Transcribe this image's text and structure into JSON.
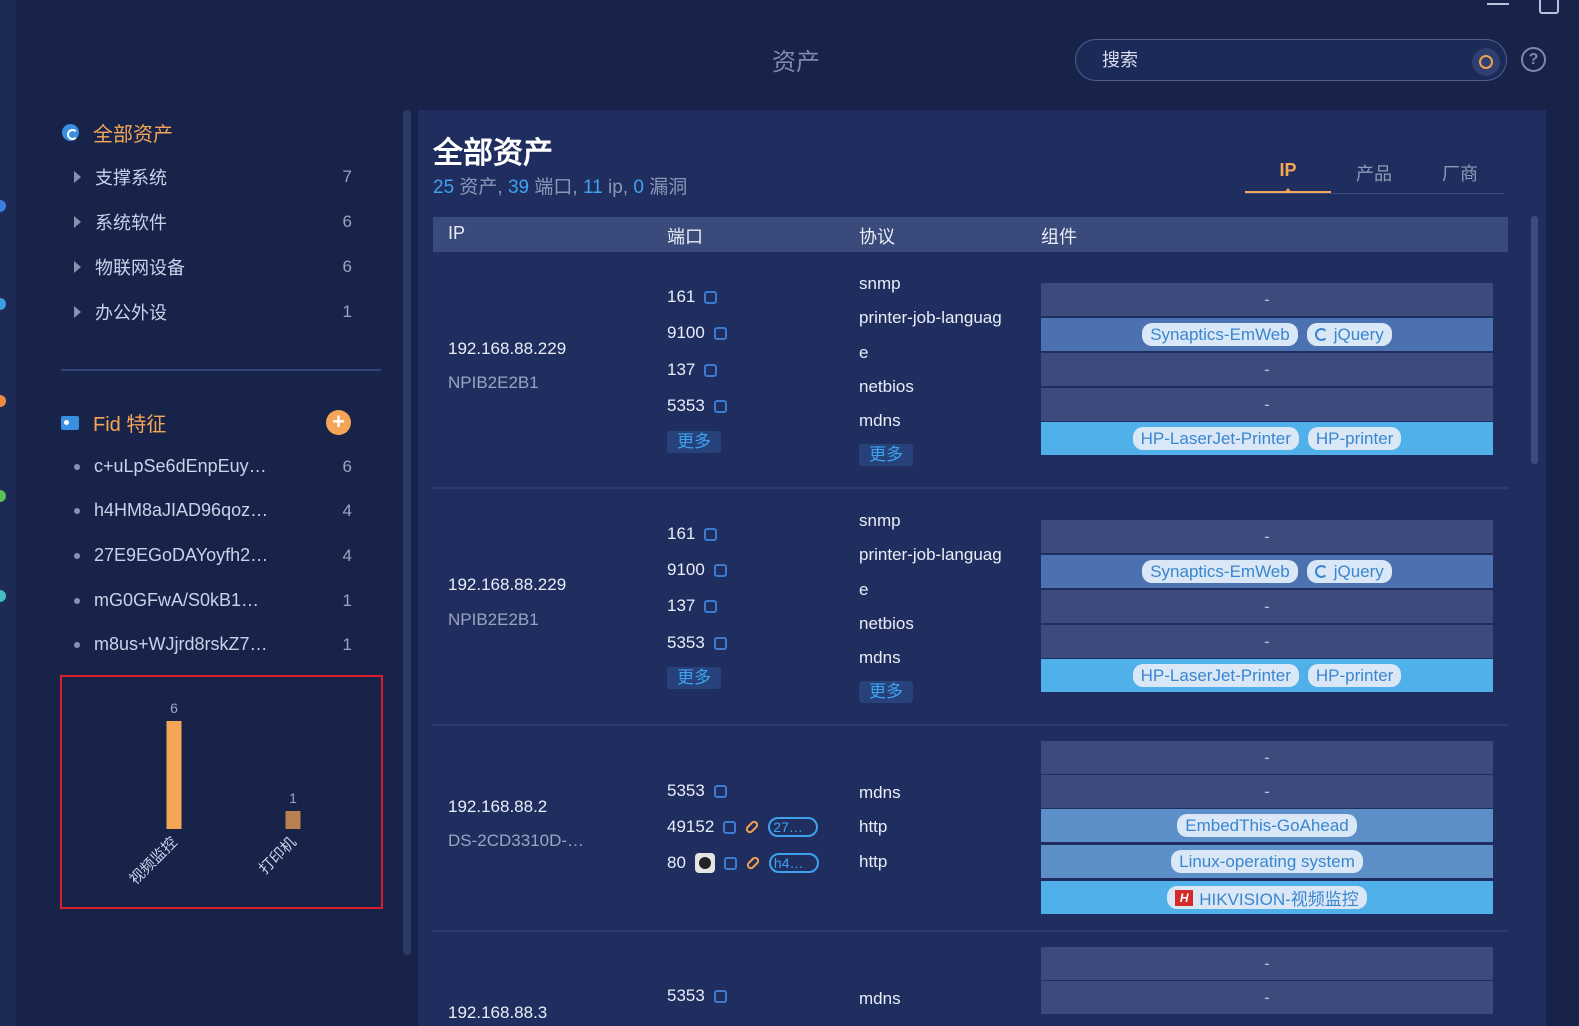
{
  "header": {
    "title": "资产",
    "search_placeholder": "搜索",
    "help_label": "?"
  },
  "sidebar": {
    "root_label": "全部资产",
    "items": [
      {
        "label": "支撑系统",
        "count": "7"
      },
      {
        "label": "系统软件",
        "count": "6"
      },
      {
        "label": "物联网设备",
        "count": "6"
      },
      {
        "label": "办公外设",
        "count": "1"
      }
    ],
    "fid_title": "Fid 特征",
    "fid_items": [
      {
        "label": "c+uLpSe6dEnpEuy…",
        "count": "6"
      },
      {
        "label": "h4HM8aJIAD96qoz…",
        "count": "4"
      },
      {
        "label": "27E9EGoDAYoyfh2…",
        "count": "4"
      },
      {
        "label": "mG0GFwA/S0kB1…",
        "count": "1"
      },
      {
        "label": "m8us+WJjrd8rskZ7…",
        "count": "1"
      }
    ]
  },
  "chart_data": {
    "type": "bar",
    "categories": [
      "视频监控",
      "打印机"
    ],
    "values": [
      6,
      1
    ],
    "colors": [
      "#f5a556",
      "#b98050"
    ],
    "ylim": [
      0,
      6
    ]
  },
  "main": {
    "title": "全部资产",
    "summary": {
      "assets": "25",
      "assets_label": "资产,",
      "ports": "39",
      "ports_label": "端口,",
      "ips": "11",
      "ips_label": "ip,",
      "vulns": "0",
      "vulns_label": "漏洞"
    },
    "tabs": [
      "IP",
      "产品",
      "厂商"
    ],
    "columns": [
      "IP",
      "端口",
      "协议",
      "组件"
    ],
    "more_label": "更多",
    "rows": [
      {
        "ip": "192.168.88.229",
        "host": "NPIB2E2B1",
        "ports": [
          "161",
          "9100",
          "137",
          "5353"
        ],
        "protocols": [
          "snmp",
          "printer-job-languag",
          "e",
          "netbios",
          "mdns"
        ],
        "components": [
          "-",
          "Synaptics-EmWeb",
          "jQuery",
          "-",
          "-",
          "HP-LaserJet-Printer",
          "HP-printer"
        ]
      },
      {
        "ip": "192.168.88.229",
        "host": "NPIB2E2B1",
        "ports": [
          "161",
          "9100",
          "137",
          "5353"
        ],
        "protocols": [
          "snmp",
          "printer-job-languag",
          "e",
          "netbios",
          "mdns"
        ],
        "components": [
          "-",
          "Synaptics-EmWeb",
          "jQuery",
          "-",
          "-",
          "HP-LaserJet-Printer",
          "HP-printer"
        ]
      },
      {
        "ip": "192.168.88.2",
        "host": "DS-2CD3310D-…",
        "ports": [
          "5353",
          "49152",
          "80"
        ],
        "port_links": [
          "27…",
          "h4…"
        ],
        "protocols": [
          "mdns",
          "http",
          "http"
        ],
        "components": [
          "-",
          "-",
          "EmbedThis-GoAhead",
          "Linux-operating system",
          "HIKVISION-视频监控"
        ]
      },
      {
        "ip": "192.168.88.3",
        "ports": [
          "5353"
        ],
        "protocols": [
          "mdns"
        ],
        "components": [
          "-",
          "-"
        ]
      }
    ]
  }
}
